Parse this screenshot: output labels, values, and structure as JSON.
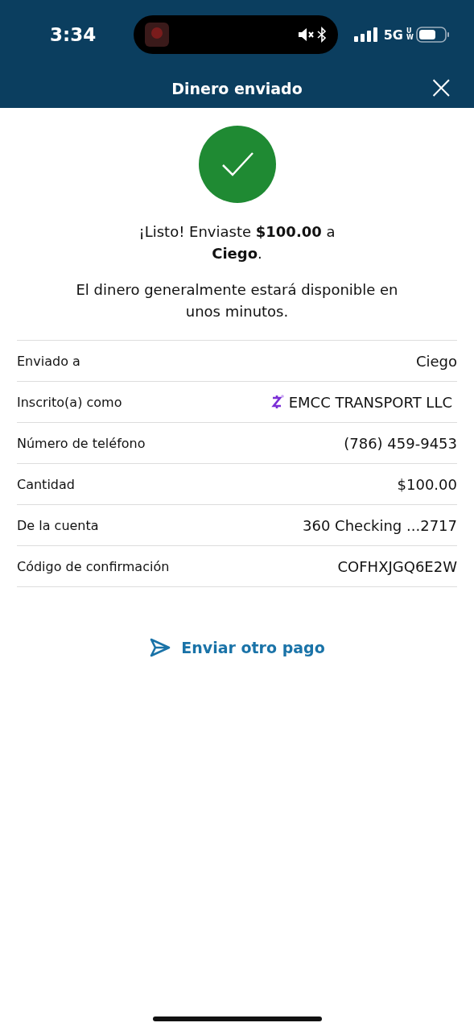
{
  "status_bar": {
    "time": "3:34",
    "network": "5G",
    "network_sub": "UW"
  },
  "header": {
    "title": "Dinero enviado",
    "close": "×"
  },
  "message": "¡Listo! Enviaste **$100.00** a **Ciego**.",
  "note": "El dinero generalmente estará disponible en unos minutos.",
  "details": [
    {
      "kind": "plain",
      "label": "Enviado a",
      "value": "Ciego"
    },
    {
      "kind": "enrolled",
      "label": "Inscrito(a) como",
      "value": "EMCC TRANSPORT LLC"
    },
    {
      "kind": "plain",
      "label": "Número de teléfono",
      "value": "(786) 459-9453"
    },
    {
      "kind": "plain",
      "label": "Cantidad",
      "value": "$100.00"
    },
    {
      "kind": "plain",
      "label": "De la cuenta",
      "value": "360 Checking ...2717"
    },
    {
      "kind": "plain",
      "label": "Código de confirmación",
      "value": "COFHXJGQ6E2W"
    }
  ],
  "action": {
    "label": "Enviar otro pago"
  }
}
